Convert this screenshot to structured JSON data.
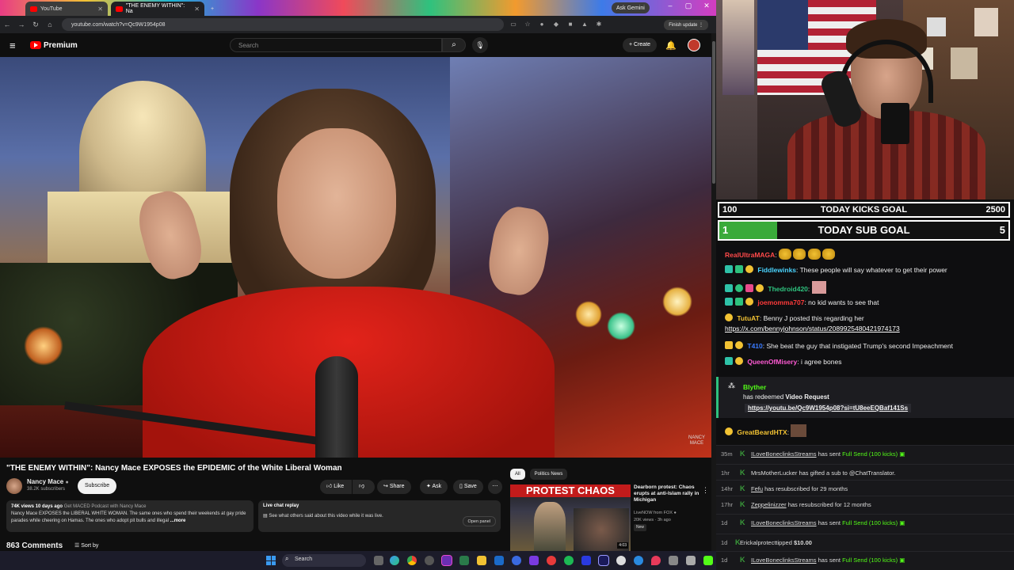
{
  "browser": {
    "tabs": [
      {
        "title": "YouTube"
      },
      {
        "title": "\"THE ENEMY WITHIN\": Na"
      }
    ],
    "url": "youtube.com/watch?v=Qc9W1954p08",
    "ask_gemini": "Ask Gemini",
    "finish_update": "Finish update"
  },
  "youtube": {
    "logo_text": "Premium",
    "search_placeholder": "Search",
    "create_label": "+ Create",
    "video": {
      "watermark_line1": "NANCY",
      "watermark_line2": "MACE",
      "title": "\"THE ENEMY WITHIN\": Nancy Mace EXPOSES the EPIDEMIC of the White Liberal Woman",
      "channel": "Nancy Mace",
      "subscribers": "38.2K subscribers",
      "subscribe_label": "Subscribe",
      "like_label": "Like",
      "share_label": "Share",
      "ask_label": "Ask",
      "save_label": "Save"
    },
    "description": {
      "views": "74K views",
      "age": "10 days ago",
      "tag": "Get MACED Podcast with Nancy Mace",
      "text": "Nancy Mace EXPOSES the LIBERAL WHITE WOMAN. The same ones who spend their weekends at gay pride parades while cheering on Hamas. The ones who adopt pit bulls and illegal",
      "more": "...more"
    },
    "live_chat": {
      "heading": "Live chat replay",
      "text": "See what others said about this video while it was live.",
      "open_panel": "Open panel"
    },
    "comments": {
      "count": "863 Comments",
      "sort": "Sort by"
    },
    "recommendations": {
      "chips": [
        "All",
        "Politics News"
      ],
      "items": [
        {
          "thumb_banner": "PROTEST CHAOS",
          "duration": "4:03",
          "title": "Dearborn protest: Chaos erupts at anti-Islam rally in Michigan",
          "channel": "LiveNOW from FOX",
          "meta": "20K views · 3h ago",
          "badge": "New"
        }
      ]
    }
  },
  "taskbar": {
    "search_placeholder": "Search"
  },
  "stream": {
    "goals": [
      {
        "left": "100",
        "label": "TODAY KICKS GOAL",
        "right": "2500",
        "progress": 0.0
      },
      {
        "left": "1",
        "label": "TODAY SUB GOAL",
        "right": "5",
        "progress": 0.2
      }
    ],
    "chat": [
      {
        "user": "RealUltraMAGA",
        "color": "#ff4a4a",
        "text": ""
      },
      {
        "user": "Fiddlewinks",
        "color": "#4ad4ff",
        "text": "These people will say whatever to get their power"
      },
      {
        "user": "Thedroid420",
        "color": "#2ec27e",
        "text": ""
      },
      {
        "user": "joemomma707",
        "color": "#ff3a3a",
        "text": "no kid wants to see that"
      },
      {
        "user": "TutuAT",
        "color": "#f2c233",
        "text": "Benny J posted this regarding her"
      },
      {
        "user": "",
        "color": "#ffffff",
        "text": "https://x.com/bennyjohnson/status/2089925480421974173"
      },
      {
        "user": "T410",
        "color": "#3a7bff",
        "text": "She beat the guy that instigated Trump's second Impeachment"
      },
      {
        "user": "QueenOfMisery",
        "color": "#ff5ad4",
        "text": "i agree bones"
      },
      {
        "user": "GreatBeardHTX",
        "color": "#f2c233",
        "text": ""
      }
    ],
    "redeem": {
      "user": "Blyther",
      "line": "has redeemed",
      "reward": "Video Request",
      "link": "https://youtu.be/Qc9W1954p08?si=tU8eeEQBaf141Ss"
    },
    "events": [
      {
        "time": "35m",
        "user": "ILoveBoneclinksStreams",
        "text": "has sent",
        "highlight": "Full Send (100 kicks)"
      },
      {
        "time": "1hr",
        "user": "MrsMotherLucker",
        "text": "has gifted a sub to @ChatTranslator.",
        "highlight": ""
      },
      {
        "time": "14hr",
        "user": "Fefu",
        "text": "has resubscribed for 29 months",
        "highlight": ""
      },
      {
        "time": "17hr",
        "user": "Zeppelinizzer",
        "text": "has resubscribed for 12 months",
        "highlight": ""
      },
      {
        "time": "1d",
        "user": "ILoveBoneclinksStreams",
        "text": "has sent",
        "highlight": "Full Send (100 kicks)"
      },
      {
        "time": "1d",
        "user": "Erickalprotecttipped",
        "text": "$10.00",
        "highlight": ""
      },
      {
        "time": "1d",
        "user": "ILoveBoneclinksStreams",
        "text": "has sent",
        "highlight": "Full Send (100 kicks)"
      }
    ]
  }
}
